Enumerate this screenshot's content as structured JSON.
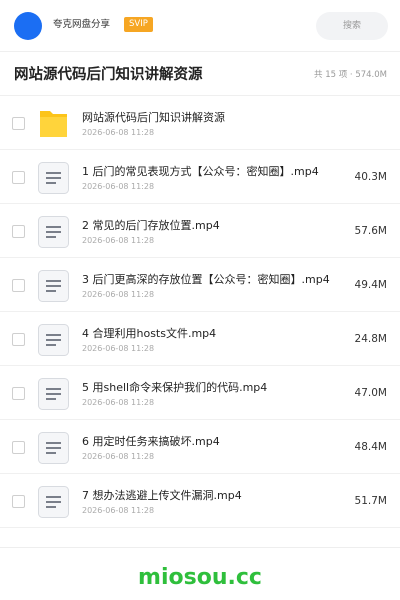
{
  "header": {
    "share_name": "夸克网盘分享",
    "badge": "SVIP",
    "search_label": "搜索",
    "avatar_color": "#1b6ef3",
    "badge_color": "#f6a623"
  },
  "folder": {
    "title": "网站源代码后门知识讲解资源",
    "summary": "共 15 项 · 574.0M"
  },
  "files": [
    {
      "name": "网站源代码后门知识讲解资源",
      "date": "2026-06-08 11:28",
      "size": "",
      "icon": "folder-icon"
    },
    {
      "name": "1 后门的常见表现方式【公众号：密知圈】.mp4",
      "date": "2026-06-08 11:28",
      "size": "40.3M",
      "icon": "file-icon"
    },
    {
      "name": "2 常见的后门存放位置.mp4",
      "date": "2026-06-08 11:28",
      "size": "57.6M",
      "icon": "file-icon"
    },
    {
      "name": "3 后门更高深的存放位置【公众号：密知圈】.mp4",
      "date": "2026-06-08 11:28",
      "size": "49.4M",
      "icon": "file-icon"
    },
    {
      "name": "4 合理利用hosts文件.mp4",
      "date": "2026-06-08 11:28",
      "size": "24.8M",
      "icon": "file-icon"
    },
    {
      "name": "5 用shell命令来保护我们的代码.mp4",
      "date": "2026-06-08 11:28",
      "size": "47.0M",
      "icon": "file-icon"
    },
    {
      "name": "6 用定时任务来搞破坏.mp4",
      "date": "2026-06-08 11:28",
      "size": "48.4M",
      "icon": "file-icon"
    },
    {
      "name": "7 想办法逃避上传文件漏洞.mp4",
      "date": "2026-06-08 11:28",
      "size": "51.7M",
      "icon": "file-icon"
    }
  ],
  "watermark": "miosou.cc",
  "colors": {
    "folder": "#fcc419",
    "watermark": "#2fbf3c"
  }
}
